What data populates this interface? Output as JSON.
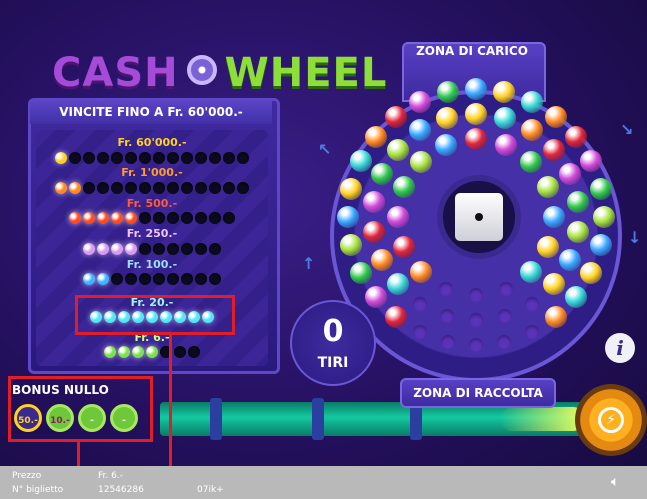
{
  "game": {
    "logo_left": "CASH",
    "logo_right": "WHEEL"
  },
  "prize_panel": {
    "title": "VINCITE FINO A Fr. 60'000.-",
    "tiers": [
      {
        "label": "Fr. 60'000.-",
        "label_color": "#ffd21e",
        "lit": 1,
        "total": 14,
        "color": "#ffd21e"
      },
      {
        "label": "Fr. 1'000.-",
        "label_color": "#ff9c2a",
        "lit": 2,
        "total": 14,
        "color": "#ff8a1e"
      },
      {
        "label": "Fr. 500.-",
        "label_color": "#ff5a3c",
        "lit": 5,
        "total": 12,
        "color": "#ff4a1e"
      },
      {
        "label": "Fr. 250.-",
        "label_color": "#f2c4ff",
        "lit": 4,
        "total": 10,
        "color": "#d89af0"
      },
      {
        "label": "Fr. 100.-",
        "label_color": "#9fdcff",
        "lit": 2,
        "total": 10,
        "color": "#3cb4ff"
      },
      {
        "label": "Fr. 20.-",
        "label_color": "#9ff6ff",
        "lit": 9,
        "total": 9,
        "color": "#4ee8f6"
      },
      {
        "label": "Fr. 6.-",
        "label_color": "#c6ff8a",
        "lit": 4,
        "total": 7,
        "color": "#7ce04a"
      }
    ]
  },
  "wheel": {
    "loading_zone": "ZONA DI CARICO",
    "collection_zone": "ZONA DI RACCOLTA",
    "ball_colors": [
      "#e0253a",
      "#ffd21e",
      "#2fc84a",
      "#ff8a1e",
      "#3aa8ff",
      "#d14ad8",
      "#36d6d6",
      "#a6e23a"
    ]
  },
  "shots": {
    "count": "0",
    "label": "TIRI"
  },
  "info_button": {
    "label": "i"
  },
  "bonus": {
    "title": "BONUS NULLO",
    "items": [
      {
        "label": "50.-",
        "bg": "#3a2a90",
        "fg": "#ffd21e",
        "ring": "#ffd21e"
      },
      {
        "label": "10.-",
        "bg": "#6ec83a",
        "fg": "#8a1a6a",
        "ring": "#a8e860"
      },
      {
        "label": "-",
        "bg": "#6ec83a",
        "fg": "#ffffff",
        "ring": "#a8e860"
      },
      {
        "label": "-",
        "bg": "#6ec83a",
        "fg": "#ffffff",
        "ring": "#a8e860"
      }
    ]
  },
  "footer": {
    "price_label": "Prezzo",
    "price_value": "Fr. 6.-",
    "ticket_label": "N° biglietto",
    "ticket_value": "12546286",
    "ticket_code": "07ik+",
    "sound_icon": "speaker-icon"
  },
  "colors": {
    "highlight_box": "#e01e2a",
    "tube": "#13c9a0",
    "play_button": "#ffb020"
  }
}
